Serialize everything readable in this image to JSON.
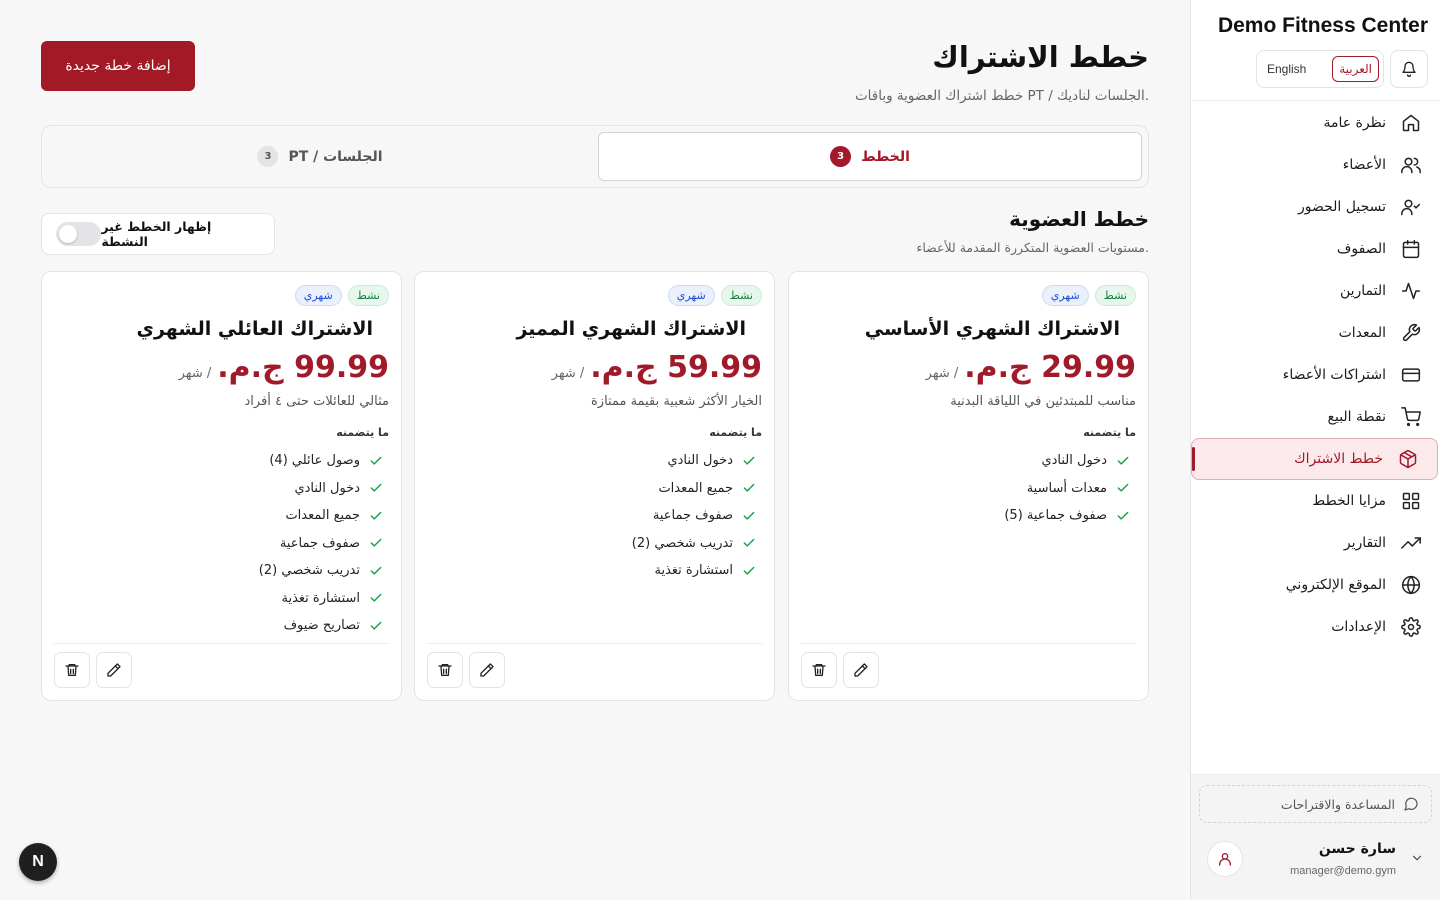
{
  "app": {
    "brand": "Demo Fitness Center",
    "lang_ar": "العربية",
    "lang_en": "English",
    "fab_label": "N"
  },
  "sidebar": {
    "items": [
      {
        "label": "نظرة عامة",
        "icon": "home-icon"
      },
      {
        "label": "الأعضاء",
        "icon": "users-icon"
      },
      {
        "label": "تسجيل الحضور",
        "icon": "user-check-icon"
      },
      {
        "label": "الصفوف",
        "icon": "calendar-icon"
      },
      {
        "label": "التمارين",
        "icon": "activity-icon"
      },
      {
        "label": "المعدات",
        "icon": "wrench-icon"
      },
      {
        "label": "اشتراكات الأعضاء",
        "icon": "credit-card-icon"
      },
      {
        "label": "نقطة البيع",
        "icon": "cart-icon"
      },
      {
        "label": "خطط الاشتراك",
        "icon": "package-icon"
      },
      {
        "label": "مزايا الخطط",
        "icon": "grid-icon"
      },
      {
        "label": "التقارير",
        "icon": "trending-up-icon"
      },
      {
        "label": "الموقع الإلكتروني",
        "icon": "globe-icon"
      },
      {
        "label": "الإعدادات",
        "icon": "settings-icon"
      }
    ],
    "active_index": 8,
    "help_label": "المساعدة والاقتراحات",
    "user": {
      "name": "سارة حسن",
      "email": "manager@demo.gym"
    }
  },
  "header": {
    "title": "خطط الاشتراك",
    "subtitle": "خطط اشتراك العضوية وباقات PT / الجلسات لناديك.",
    "add_button": "إضافة خطة جديدة"
  },
  "tabs": [
    {
      "label": "الخطط",
      "count": "3",
      "active": true
    },
    {
      "label": "PT / الجلسات",
      "count": "3",
      "active": false
    }
  ],
  "section": {
    "title": "خطط العضوية",
    "subtitle": "مستويات العضوية المتكررة المقدمة للأعضاء.",
    "toggle_label": "إظهار الخطط غير النشطة",
    "toggle_on": false
  },
  "plans": [
    {
      "frequency": "شهري",
      "status": "نشط",
      "name": "الاشتراك الشهري الأساسي",
      "price": "29.99 ج.م.",
      "per": "/ شهر",
      "description": "مناسب للمبتدئين في اللياقة البدنية",
      "includes_label": "ما يتضمنه",
      "features": [
        "دخول النادي",
        "معدات أساسية",
        "صفوف جماعية (5)"
      ]
    },
    {
      "frequency": "شهري",
      "status": "نشط",
      "name": "الاشتراك الشهري المميز",
      "price": "59.99 ج.م.",
      "per": "/ شهر",
      "description": "الخيار الأكثر شعبية بقيمة ممتازة",
      "includes_label": "ما يتضمنه",
      "features": [
        "دخول النادي",
        "جميع المعدات",
        "صفوف جماعية",
        "تدريب شخصي (2)",
        "استشارة تغذية"
      ]
    },
    {
      "frequency": "شهري",
      "status": "نشط",
      "name": "الاشتراك العائلي الشهري",
      "price": "99.99 ج.م.",
      "per": "/ شهر",
      "description": "مثالي للعائلات حتى ٤ أفراد",
      "includes_label": "ما يتضمنه",
      "features": [
        "وصول عائلي (4)",
        "دخول النادي",
        "جميع المعدات",
        "صفوف جماعية",
        "تدريب شخصي (2)",
        "استشارة تغذية",
        "تصاريح ضيوف"
      ]
    }
  ],
  "colors": {
    "accent": "#a11a2a",
    "active_nav_bg": "#fbe9ec",
    "badge_blue": "#1d4ed8",
    "badge_green": "#15803d"
  }
}
